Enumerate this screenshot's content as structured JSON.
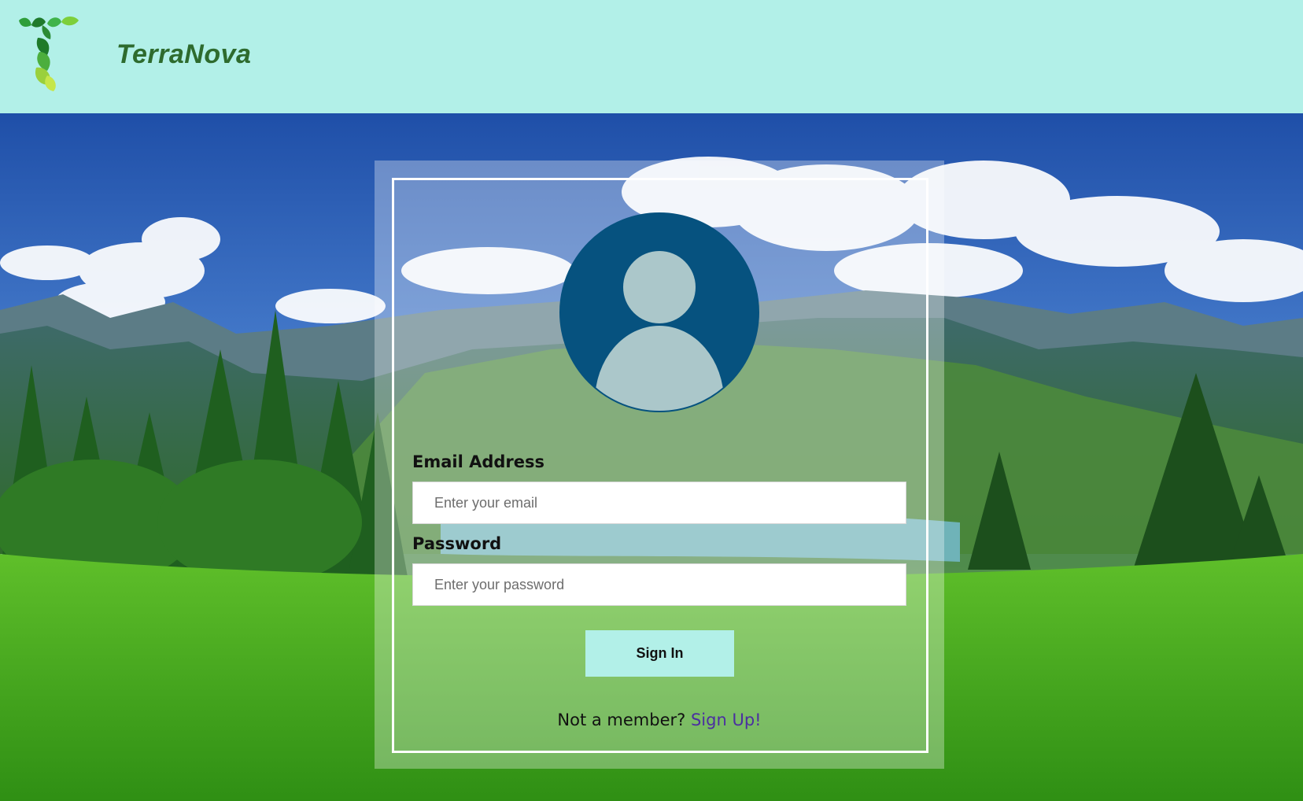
{
  "header": {
    "brand_name": "TerraNova",
    "logo_icon": "leaf-t-logo",
    "background_color": "#b2f0e8",
    "brand_color": "#2e6b2e"
  },
  "login_form": {
    "avatar_icon": "user-avatar-icon",
    "avatar_color": "#06527f",
    "email_label": "Email Address",
    "email_placeholder": "Enter your email",
    "email_value": "",
    "password_label": "Password",
    "password_placeholder": "Enter your password",
    "password_value": "",
    "signin_label": "Sign In",
    "signin_color": "#b2f0e8",
    "signup_prompt": "Not a member?",
    "signup_link": "Sign Up!",
    "signup_link_color": "#4b2fa0"
  },
  "background": {
    "image": "mountain-lake-meadow-landscape"
  }
}
